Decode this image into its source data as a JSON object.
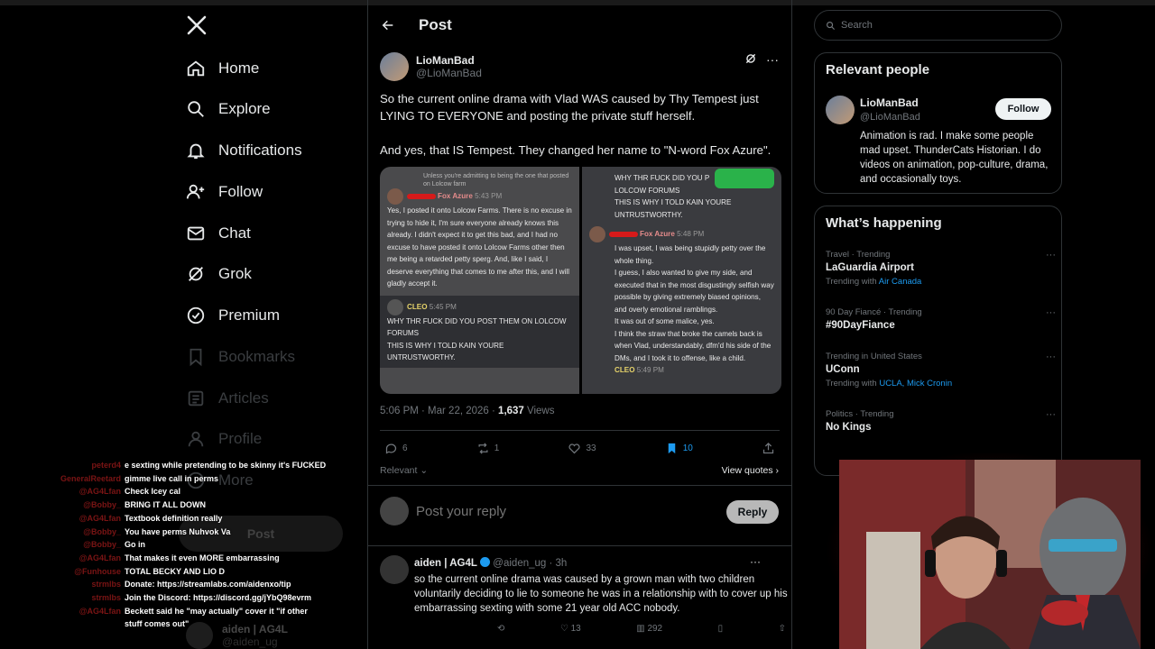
{
  "nav": {
    "items": [
      {
        "label": "Home"
      },
      {
        "label": "Explore"
      },
      {
        "label": "Notifications"
      },
      {
        "label": "Follow"
      },
      {
        "label": "Chat"
      },
      {
        "label": "Grok"
      },
      {
        "label": "Premium"
      },
      {
        "label": "Bookmarks"
      },
      {
        "label": "Articles"
      },
      {
        "label": "Profile"
      },
      {
        "label": "More"
      }
    ],
    "post_label": "Post",
    "profile_name": "aiden | AG4L",
    "profile_handle": "@aiden_ug"
  },
  "chat": [
    {
      "user": "peterd4",
      "msg": "e sexting while pretending to be skinny it's FUCKED"
    },
    {
      "user": "GeneralReetard",
      "msg": "gimme live call in perms"
    },
    {
      "user": "@AG4Lfan",
      "msg": "Check Icey cal"
    },
    {
      "user": "@Bobby_",
      "msg": "BRING IT ALL DOWN"
    },
    {
      "user": "@AG4Lfan",
      "msg": "Textbook definition really"
    },
    {
      "user": "@Bobby_",
      "msg": "You have perms Nuhvok Va"
    },
    {
      "user": "@Bobby_",
      "msg": "Go in"
    },
    {
      "user": "@AG4Lfan",
      "msg": "That makes it even MORE embarrassing"
    },
    {
      "user": "@Funhouse",
      "msg": "TOTAL BECKY AND LIO D"
    },
    {
      "user": "strmlbs",
      "msg": "Donate: https://streamlabs.com/aidenxo/tip"
    },
    {
      "user": "strmlbs",
      "msg": "Join the Discord: https://discord.gg/jYbQ98evrm"
    },
    {
      "user": "@AG4Lfan",
      "msg": "Beckett said he \"may actually\" cover it \"if other stuff comes out\""
    }
  ],
  "post": {
    "header_title": "Post",
    "author_name": "LioManBad",
    "author_handle": "@LioManBad",
    "text": "So the current online drama with Vlad WAS caused by Thy Tempest just LYING TO EVERYONE and posting the private stuff herself.\n\nAnd yes, that IS Tempest. They changed her name to \"N-word Fox Azure\".",
    "media": {
      "left": {
        "quote": "Unless you're admitting to being the one that posted on Lolcow farm",
        "user": "Fox Azure",
        "time": "5:43 PM",
        "body": "Yes, I posted it onto Lolcow Farms. There is no excuse in trying to hide it, I'm sure everyone already knows this already. I didn't expect it to get this bad, and I had no excuse to have posted it onto Lolcow Farms other then me being a retarded petty sperg. And, like I said, I deserve everything that comes to me after this, and I will gladly accept it.",
        "user2": "CLEO",
        "time2": "5:45 PM",
        "body2": "WHY THR FUCK DID YOU POST THEM ON LOLCOW FORUMS\nTHIS IS WHY I TOLD KAIN YOURE UNTRUSTWORTHY."
      },
      "right": {
        "top": "WHY THR FUCK DID YOU P\nLOLCOW FORUMS\nTHIS IS WHY I TOLD KAIN YOURE\nUNTRUSTWORTHY.",
        "user": "Fox Azure",
        "time": "5:48 PM",
        "body": "I was upset, I was being stupidly petty over the whole thing.\nI guess, I also wanted to give my side, and executed that in the most disgustingly selfish way possible by giving extremely biased opinions, and overly emotional ramblings.\nIt was out of some malice, yes.\nI think the straw that broke the camels back is when Vlad, understandably, dfm'd his side of the DMs, and I took it to offense, like a child.",
        "user2": "CLEO",
        "time2": "5:49 PM"
      }
    },
    "time": "5:06 PM · Mar 22, 2026 · ",
    "views_count": "1,637",
    "views_label": " Views",
    "replies": "6",
    "reposts": "1",
    "likes": "33",
    "bookmarks": "10",
    "relevant_label": "Relevant",
    "view_quotes": "View quotes",
    "reply_placeholder": "Post your reply",
    "reply_button": "Reply"
  },
  "reply": {
    "name": "aiden | AG4L",
    "handle": "@aiden_ug · 3h",
    "text": "so the current online drama was caused by a grown man with two children voluntarily deciding to lie to someone he was in a relationship with to cover up his embarrassing sexting with some 21 year old ACC nobody.",
    "likes": "13",
    "views": "292"
  },
  "right": {
    "search_placeholder": "Search",
    "relevant_title": "Relevant people",
    "person_name": "LioManBad",
    "person_handle": "@LioManBad",
    "follow_label": "Follow",
    "bio": "Animation is rad. I make some people mad upset. ThunderCats Historian. I do videos on animation, pop-culture, drama, and occasionally toys.",
    "happening_title": "What’s happening",
    "trends": [
      {
        "cat": "Travel · Trending",
        "title": "LaGuardia Airport",
        "sub_prefix": "Trending with ",
        "sub_links": "Air Canada"
      },
      {
        "cat": "90 Day Fiancé · Trending",
        "title": "#90DayFiance",
        "sub_prefix": "",
        "sub_links": ""
      },
      {
        "cat": "Trending in United States",
        "title": "UConn",
        "sub_prefix": "Trending with ",
        "sub_links": "UCLA, Mick Cronin"
      },
      {
        "cat": "Politics · Trending",
        "title": "No Kings",
        "sub_prefix": "",
        "sub_links": ""
      }
    ]
  },
  "colors": {
    "accent": "#1d9bf0",
    "background": "#000000",
    "border": "#2f3336"
  }
}
